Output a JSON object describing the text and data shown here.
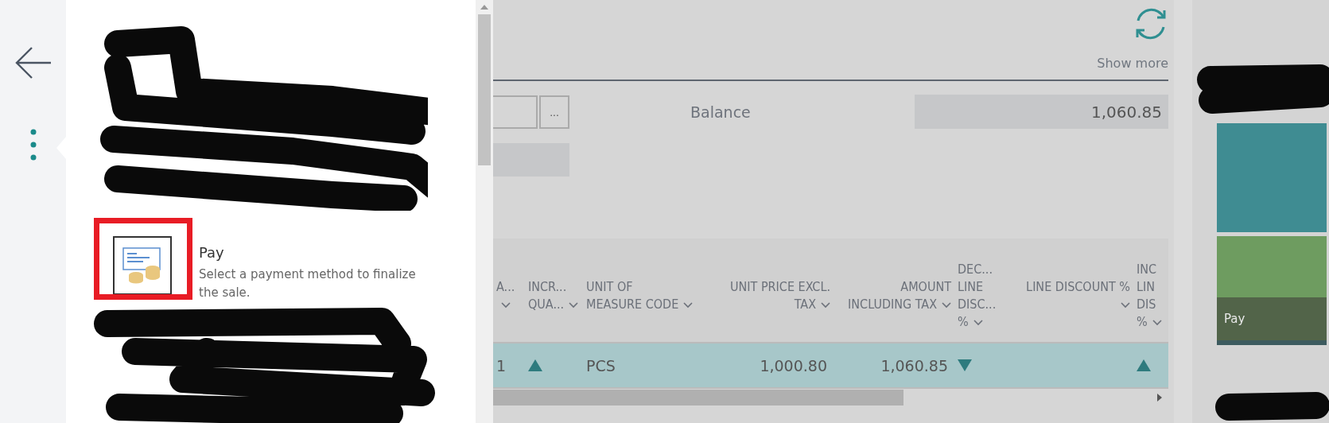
{
  "actions": [
    {
      "title": "Pay",
      "description": "Select a payment method to finalize the sale.",
      "highlighted": true
    }
  ],
  "header": {
    "show_more": "Show more"
  },
  "fields": {
    "lookup_button": "...",
    "balance_label": "Balance",
    "balance_value": "1,060.85"
  },
  "table": {
    "columns": [
      {
        "label": "A..."
      },
      {
        "label": "INCR...\nQUA..."
      },
      {
        "label": "UNIT OF\nMEASURE CODE"
      },
      {
        "label": "UNIT PRICE EXCL.\nTAX"
      },
      {
        "label": "AMOUNT\nINCLUDING TAX"
      },
      {
        "label": "DEC...\nLINE\nDISC...\n%"
      },
      {
        "label": "LINE DISCOUNT %"
      },
      {
        "label": "INC\nLIN\nDIS\n%"
      }
    ],
    "rows": [
      {
        "selected": true,
        "cells": [
          {
            "kind": "text",
            "text": "1"
          },
          {
            "kind": "up"
          },
          {
            "kind": "text",
            "text": "PCS"
          },
          {
            "kind": "text",
            "text": "1,000.80"
          },
          {
            "kind": "text",
            "text": "1,060.85"
          },
          {
            "kind": "down"
          },
          {
            "kind": "blank"
          },
          {
            "kind": "up"
          }
        ]
      }
    ]
  },
  "tiles": [
    {
      "color": "#3f8c92"
    },
    {
      "color": "#6e9c60",
      "label": "Pay"
    }
  ]
}
